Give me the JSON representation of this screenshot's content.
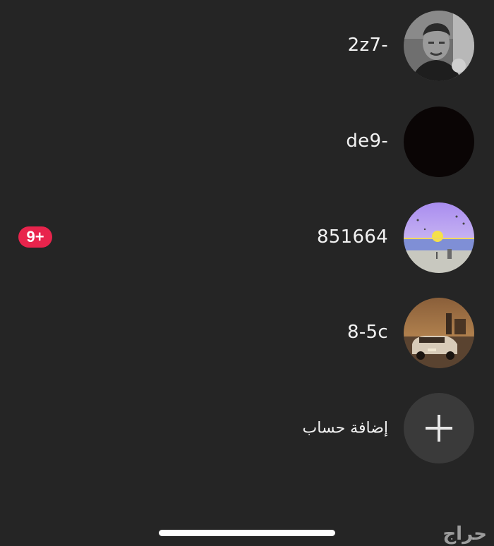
{
  "accounts": [
    {
      "username": "2z7-",
      "avatar": "portrait-photo-avatar",
      "badge": ""
    },
    {
      "username": "de9-",
      "avatar": "black-avatar",
      "badge": ""
    },
    {
      "username": "851664",
      "avatar": "sunset-beach-avatar",
      "badge": "9+"
    },
    {
      "username": "8-5c",
      "avatar": "vintage-car-avatar",
      "badge": ""
    }
  ],
  "add_account": {
    "label": "إضافة حساب",
    "icon": "plus-icon"
  },
  "watermark": "حراج",
  "colors": {
    "background": "#252525",
    "badge": "#e8244c",
    "add_circle": "#3a3a3a",
    "text": "#f2f2f2"
  }
}
